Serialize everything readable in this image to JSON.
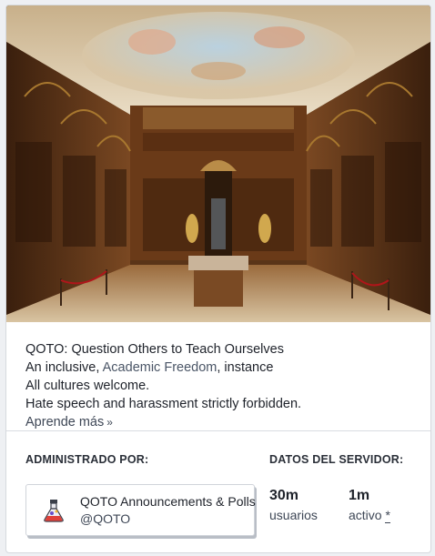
{
  "hero": {
    "image_alt": "Baroque library hall with frescoed ceiling"
  },
  "about": {
    "line1": "QOTO: Question Others to Teach Ourselves",
    "line2_prefix": "An inclusive, ",
    "line2_link": "Academic Freedom",
    "line2_suffix": ", instance",
    "line3": "All cultures welcome.",
    "line4": "Hate speech and harassment strictly forbidden.",
    "more_label": "Aprende más",
    "more_icon": "double-chevron-right-icon"
  },
  "admin": {
    "heading": "ADMINISTRADO POR:",
    "display_name": "QOTO Announcements & Polls",
    "handle": "@QOTO",
    "avatar_icon": "flask-logo-icon"
  },
  "server_stats": {
    "heading": "DATOS DEL SERVIDOR:",
    "users_value": "30m",
    "users_label": "usuarios",
    "active_value": "1m",
    "active_label": "activo",
    "active_marker": "*"
  },
  "colors": {
    "link": "#4a5566",
    "text": "#1e222a",
    "muted": "#3e4756",
    "border": "#d0d4da"
  }
}
